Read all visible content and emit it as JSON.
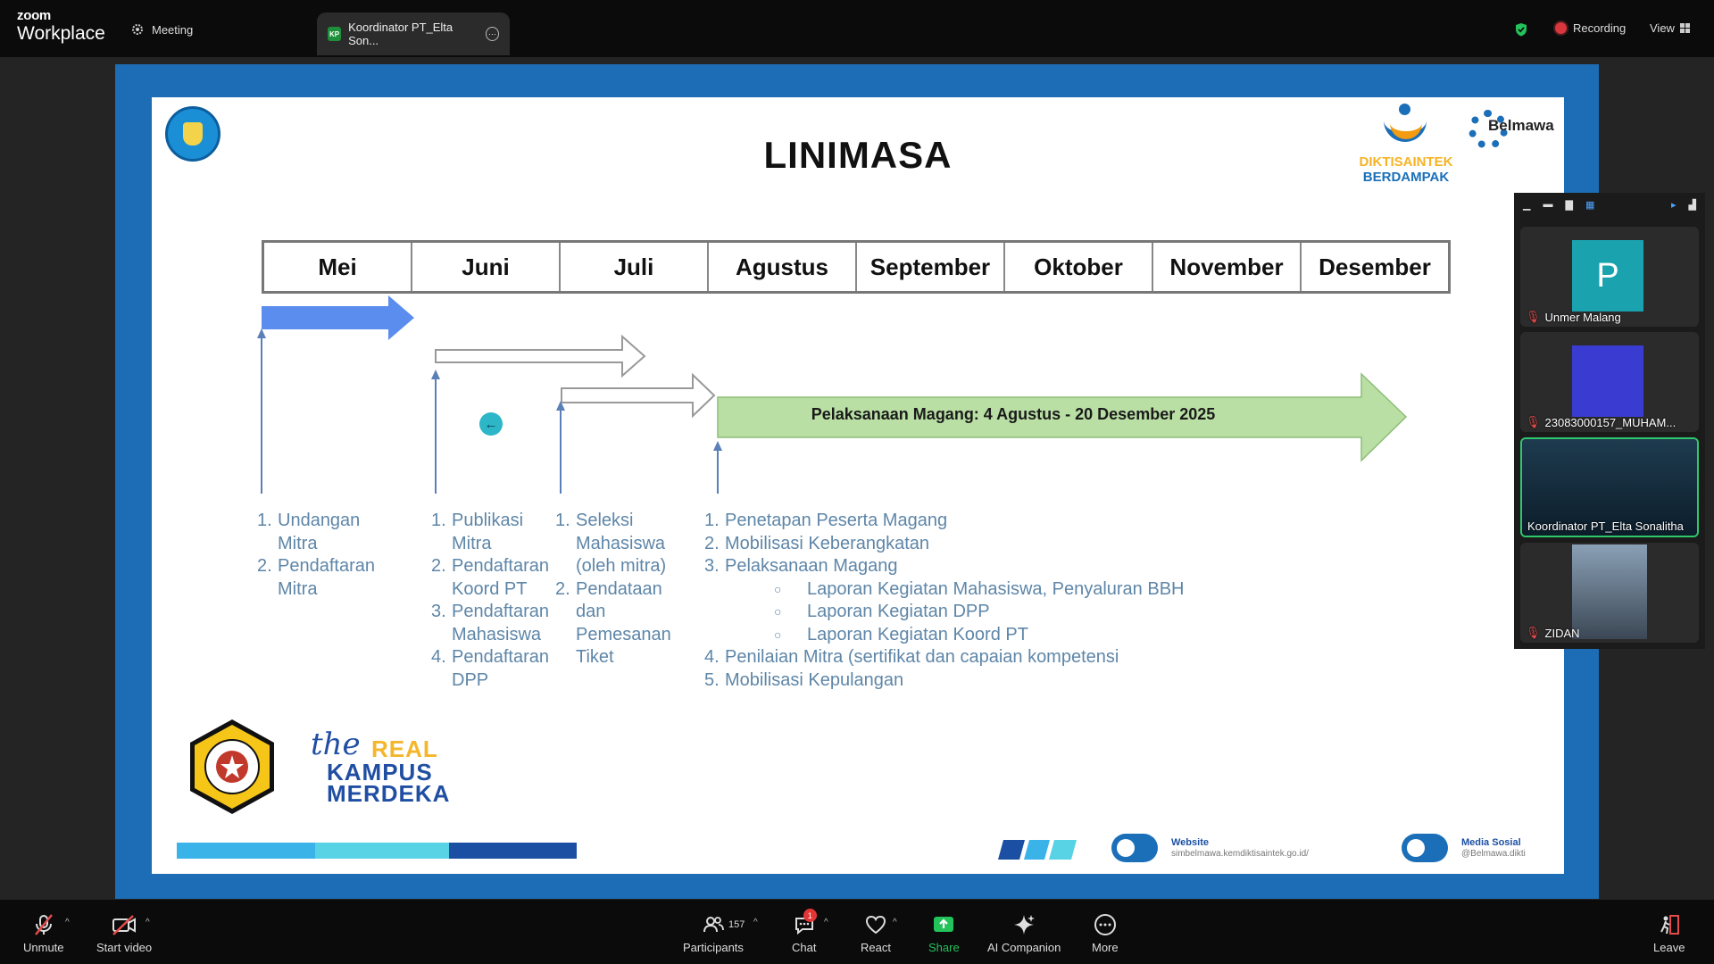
{
  "app": {
    "brand_top": "zoom",
    "brand_bottom": "Workplace"
  },
  "topbar": {
    "meeting_label": "Meeting",
    "share_tab_badge": "KP",
    "share_tab_label": "Koordinator PT_Elta Son...",
    "recording_label": "Recording",
    "view_label": "View"
  },
  "slide": {
    "title": "LINIMASA",
    "dikti_line1": "DIKTISAINTEK",
    "dikti_line2": "BERDAMPAK",
    "belmawa": "Belmawa",
    "months": [
      "Mei",
      "Juni",
      "Juli",
      "Agustus",
      "September",
      "Oktober",
      "November",
      "Desember"
    ],
    "magang_label": "Pelaksanaan Magang: 4 Agustus - 20 Desember 2025",
    "col1": [
      {
        "n": "1.",
        "text": "Undangan Mitra"
      },
      {
        "n": "2.",
        "text": "Pendaftaran Mitra"
      }
    ],
    "col2": [
      {
        "n": "1.",
        "text": "Publikasi Mitra"
      },
      {
        "n": "2.",
        "text": "Pendaftaran Koord PT"
      },
      {
        "n": "3.",
        "text": "Pendaftaran Mahasiswa"
      },
      {
        "n": "4.",
        "text": "Pendaftaran DPP"
      }
    ],
    "col3": [
      {
        "n": "1.",
        "text": "Seleksi Mahasiswa (oleh mitra)"
      },
      {
        "n": "2.",
        "text": "Pendataan dan Pemesanan Tiket"
      }
    ],
    "col4": [
      {
        "n": "1.",
        "text": "Penetapan Peserta Magang"
      },
      {
        "n": "2.",
        "text": "Mobilisasi Keberangkatan"
      },
      {
        "n": "3.",
        "text": "Pelaksanaan Magang"
      }
    ],
    "col4_sub": [
      "Laporan Kegiatan Mahasiswa, Penyaluran BBH",
      "Laporan Kegiatan DPP",
      "Laporan Kegiatan Koord PT"
    ],
    "col4_tail": [
      {
        "n": "4.",
        "text": "Penilaian Mitra (sertifikat dan capaian kompetensi"
      },
      {
        "n": "5.",
        "text": "Mobilisasi Kepulangan"
      }
    ],
    "krm_the": "the",
    "krm_real": "REAL",
    "krm_kampus": "KAMPUS",
    "krm_merdeka": "MERDEKA",
    "footer_website_title": "Website",
    "footer_website_url": "simbelmawa.kemdiktisaintek.go.id/",
    "footer_social_title": "Media Sosial",
    "footer_social_handle": "@Belmawa.dikti"
  },
  "participants": [
    {
      "name": "Unmer Malang",
      "initial": "P"
    },
    {
      "name": "23083000157_MUHAM..."
    },
    {
      "name": "Koordinator PT_Elta Sonalitha"
    },
    {
      "name": "ZIDAN"
    }
  ],
  "toolbar": {
    "unmute": "Unmute",
    "start_video": "Start video",
    "participants": "Participants",
    "participants_count": "157",
    "chat": "Chat",
    "chat_badge": "1",
    "react": "React",
    "share": "Share",
    "ai_companion": "AI Companion",
    "more": "More",
    "leave": "Leave"
  },
  "colors": {
    "accent_green": "#23c25a",
    "recording_red": "#d9363e",
    "slide_frame_blue": "#1c6db5",
    "magang_arrow": "#b9dfa4"
  }
}
